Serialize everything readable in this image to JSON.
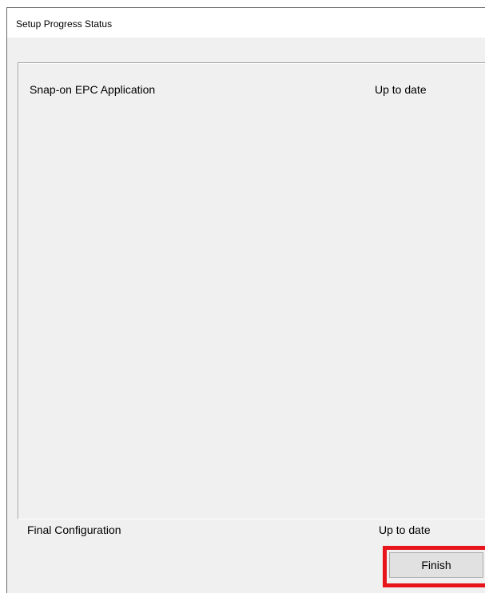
{
  "window": {
    "title": "Setup Progress Status"
  },
  "progress_list": {
    "items": [
      {
        "name": "Snap-on EPC Application",
        "status": "Up to date"
      }
    ]
  },
  "final_step": {
    "name": "Final Configuration",
    "status": "Up to date"
  },
  "buttons": {
    "finish_label": "Finish"
  },
  "colors": {
    "highlight_border": "#e8141b",
    "dialog_background": "#f0f0f0"
  }
}
